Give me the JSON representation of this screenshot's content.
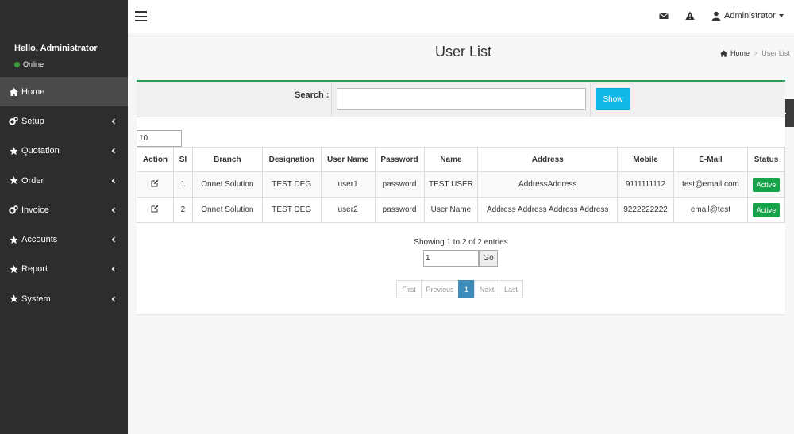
{
  "sidebar": {
    "greeting": "Hello, Administrator",
    "status": "Online",
    "status_color": "#3c9a3c",
    "items": [
      {
        "label": "Home",
        "icon": "home-icon",
        "active": true
      },
      {
        "label": "Setup",
        "icon": "cogs-icon"
      },
      {
        "label": "Quotation",
        "icon": "star-icon"
      },
      {
        "label": "Order",
        "icon": "star-icon"
      },
      {
        "label": "Invoice",
        "icon": "cogs-icon"
      },
      {
        "label": "Accounts",
        "icon": "star-icon"
      },
      {
        "label": "Report",
        "icon": "star-icon"
      },
      {
        "label": "System",
        "icon": "star-icon"
      }
    ]
  },
  "topbar": {
    "user_label": "Administrator",
    "icons": [
      "hamburger-icon",
      "envelope-icon",
      "warning-icon",
      "user-icon"
    ]
  },
  "header": {
    "title": "User List",
    "breadcrumb": {
      "home": "Home",
      "current": "User List"
    }
  },
  "search": {
    "label": "Search :",
    "value": "",
    "button": "Show"
  },
  "page_length": "10",
  "table": {
    "columns": [
      "Action",
      "Sl",
      "Branch",
      "Designation",
      "User Name",
      "Password",
      "Name",
      "Address",
      "Mobile",
      "E-Mail",
      "Status"
    ],
    "rows": [
      {
        "sl": "1",
        "branch": "Onnet Solution",
        "designation": "TEST DEG",
        "username": "user1",
        "password": "password",
        "name": "TEST USER",
        "address": "AddressAddress",
        "mobile": "9111111112",
        "email": "test@email.com",
        "status": "Active"
      },
      {
        "sl": "2",
        "branch": "Onnet Solution",
        "designation": "TEST DEG",
        "username": "user2",
        "password": "password",
        "name": "User Name",
        "address": "Address Address Address Address",
        "mobile": "9222222222",
        "email": "email@test",
        "status": "Active"
      }
    ]
  },
  "info": "Showing 1 to 2 of 2 entries",
  "goto": {
    "value": "1",
    "button": "Go"
  },
  "pagination": [
    "First",
    "Previous",
    "1",
    "Next",
    "Last"
  ],
  "colors": {
    "accent": "#2e9b51",
    "button": "#12b9e8",
    "active_badge": "#16a34a",
    "page_active": "#3c8dbc",
    "sidebar": "#2d2d2d"
  }
}
